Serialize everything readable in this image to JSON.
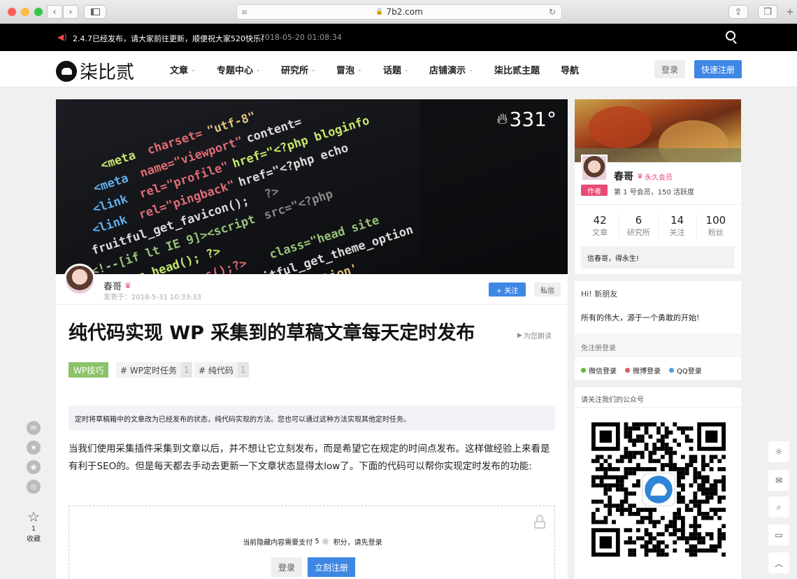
{
  "browser": {
    "url": "7b2.com"
  },
  "notice": {
    "text": "2.4.7已经发布，请大家前往更新，顺便祝大家520快乐！",
    "time": "2018-05-20 01:08:34"
  },
  "site": {
    "logo_text": "柒比贰"
  },
  "nav": [
    {
      "label": "文章",
      "dropdown": true
    },
    {
      "label": "专题中心",
      "dropdown": true
    },
    {
      "label": "研究所",
      "dropdown": true
    },
    {
      "label": "冒泡",
      "dropdown": true
    },
    {
      "label": "话题",
      "dropdown": true
    },
    {
      "label": "店铺演示",
      "dropdown": true
    },
    {
      "label": "柒比贰主题",
      "dropdown": false
    },
    {
      "label": "导航",
      "dropdown": false
    }
  ],
  "header": {
    "login": "登录",
    "register": "快速注册"
  },
  "hero": {
    "heat": "331°"
  },
  "author": {
    "name": "春哥",
    "posted": "发表于：2018-5-31 10:33:33",
    "follow": "+ 关注",
    "message": "私信"
  },
  "article": {
    "title": "纯代码实现 WP 采集到的草稿文章每天定时发布",
    "read_aloud": "为您朗读",
    "category": "WP技巧",
    "tags": [
      {
        "label": "# WP定时任务",
        "count": "1"
      },
      {
        "label": "# 纯代码",
        "count": "1"
      }
    ],
    "summary": "定时将草稿箱中的文章改为已经发布的状态，纯代码实现的方法。您也可以通过这种方法实现其他定时任务。",
    "paragraph": "当我们使用采集插件采集到文章以后，并不想让它立刻发布，而是希望它在规定的时间点发布。这样做经验上来看是有利于SEO的。但是每天都去手动去更新一下文章状态显得太low了。下面的代码可以帮你实现定时发布的功能:",
    "hidden_prefix": "当前隐藏内容需要支付",
    "hidden_amount": "5",
    "hidden_suffix": "积分，请先登录",
    "hidden_login": "登录",
    "hidden_register": "立刻注册"
  },
  "left_share": {
    "fav_count": "1",
    "fav_label": "收藏"
  },
  "profile": {
    "name": "春哥",
    "vip": "永久会员",
    "role": "作者",
    "meta": "第 1 号会员，150 活跃度",
    "stats": [
      {
        "value": "42",
        "label": "文章"
      },
      {
        "value": "6",
        "label": "研究所"
      },
      {
        "value": "14",
        "label": "关注"
      },
      {
        "value": "100",
        "label": "粉丝"
      }
    ],
    "motto": "信春哥，得永生!"
  },
  "welcome": {
    "title": "Hi! 新朋友",
    "text": "所有的伟大，源于一个勇敢的开始!",
    "social_title": "免注册登录",
    "social": [
      {
        "label": "微信登录",
        "color": "#5fb936"
      },
      {
        "label": "微博登录",
        "color": "#d95c5c"
      },
      {
        "label": "QQ登录",
        "color": "#4a9fe6"
      }
    ]
  },
  "qr": {
    "title": "请关注我们的公众号"
  }
}
